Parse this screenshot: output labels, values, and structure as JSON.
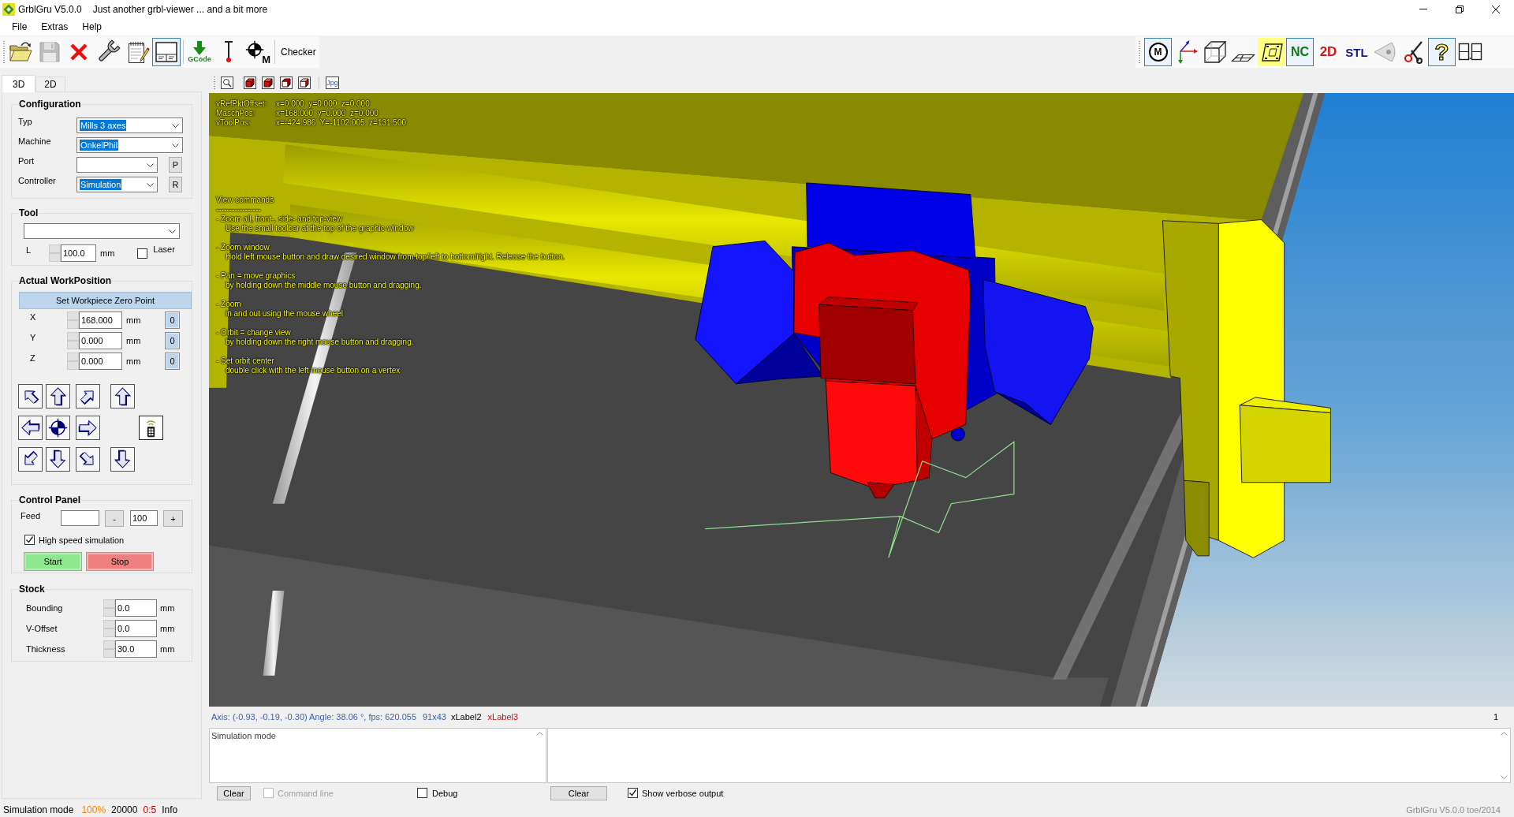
{
  "window": {
    "title": "GrblGru V5.0.0",
    "subtitle": "Just another grbl-viewer ... and a bit more"
  },
  "menu": [
    {
      "label": "File"
    },
    {
      "label": "Extras"
    },
    {
      "label": "Help"
    }
  ],
  "toolbar": {
    "groups": [
      [
        {
          "pressed": false,
          "disabled": false
        },
        {
          "pressed": false,
          "disabled": true
        },
        {
          "pressed": false,
          "disabled": false
        },
        {
          "pressed": false,
          "disabled": false
        },
        {
          "pressed": false,
          "disabled": false
        },
        {
          "pressed": true,
          "disabled": false
        }
      ],
      [
        {
          "label": "GCode",
          "pressed": false,
          "disabled": false
        },
        {
          "pressed": false,
          "disabled": false
        },
        {
          "label": "M",
          "pressed": false,
          "disabled": false
        }
      ],
      [
        {
          "label": "Checker",
          "pressed": false,
          "disabled": false
        }
      ]
    ]
  },
  "view_toolbar": {
    "items": [
      {
        "label": "M",
        "pressed": true,
        "highlighted": false
      },
      {
        "pressed": false,
        "highlighted": false
      },
      {
        "pressed": false,
        "highlighted": false
      },
      {
        "pressed": false,
        "highlighted": false
      },
      {
        "pressed": false,
        "highlighted": true
      },
      {
        "label": "NC",
        "pressed": true,
        "highlighted": false
      },
      {
        "label": "2D",
        "pressed": false,
        "highlighted": false
      },
      {
        "label": "STL",
        "pressed": false,
        "highlighted": false
      },
      {
        "pressed": false,
        "highlighted": false
      },
      {
        "pressed": false,
        "highlighted": false
      },
      {
        "label": "?",
        "pressed": true,
        "highlighted": false
      },
      {
        "pressed": false,
        "highlighted": false
      }
    ]
  },
  "tabs": [
    {
      "label": "3D",
      "selected": true
    },
    {
      "label": "2D",
      "selected": false
    }
  ],
  "view_tools": {
    "export_label": "Jpg"
  },
  "configuration": {
    "title": "Configuration",
    "fields": [
      {
        "label": "Typ",
        "value": "Mills 3 axes",
        "highlighted": true
      },
      {
        "label": "Machine",
        "value": "OnkelPhil",
        "highlighted": true
      },
      {
        "label": "Port",
        "button": "P"
      },
      {
        "label": "Controller",
        "value": "Simulation",
        "highlighted": true,
        "button": "R"
      }
    ]
  },
  "tool": {
    "title": "Tool",
    "length_label": "L",
    "length": "100.0",
    "unit": "mm",
    "laser": {
      "label": "Laser",
      "checked": false
    }
  },
  "work_position": {
    "title": "Actual WorkPosition",
    "zero_button": "Set Workpiece Zero Point",
    "axes": [
      {
        "label": "X",
        "value": "168.000",
        "unit": "mm",
        "button": "0"
      },
      {
        "label": "Y",
        "value": "0.000",
        "unit": "mm",
        "button": "0"
      },
      {
        "label": "Z",
        "value": "0.000",
        "unit": "mm",
        "button": "0"
      }
    ]
  },
  "control_panel": {
    "title": "Control Panel",
    "feed_label": "Feed",
    "minus": "-",
    "override": "100",
    "plus": "+",
    "high_speed": {
      "label": "High speed simulation",
      "checked": true
    },
    "start": "Start",
    "stop": "Stop"
  },
  "stock": {
    "title": "Stock",
    "fields": [
      {
        "label": "Bounding",
        "value": "0.0",
        "unit": "mm"
      },
      {
        "label": "V-Offset",
        "value": "0.0",
        "unit": "mm"
      },
      {
        "label": "Thickness",
        "value": "30.0",
        "unit": "mm"
      }
    ]
  },
  "viewport": {
    "positions": [
      {
        "label": "vRefPktOffset:",
        "values": "x=0.000  y=0.000  z=0.000"
      },
      {
        "label": "MaschPos:",
        "values": "x=168.000  y=0.000  z=0.000"
      },
      {
        "label": "vToolPos:",
        "values": "x=-424.986  Y=-1102.005  z=131.500"
      }
    ],
    "help": {
      "title": "View commands",
      "rule": "-----------------",
      "commands": [
        {
          "name": "- Zoom all, front-, side- and top-view",
          "detail": "Use the small toolbar at the top of the graphic-window"
        },
        {
          "name": "- Zoom window",
          "detail": "Hold left mouse button and draw desired window from top/left to bottom/right. Release the button."
        },
        {
          "name": "- Pan = move graphics",
          "detail": "by holding down the middle mouse button and dragging."
        },
        {
          "name": "- Zoom",
          "detail": "in and out using the mouse wheel"
        },
        {
          "name": "- Orbit = change view",
          "detail": "by holding down the right mouse button and dragging."
        },
        {
          "name": "- Set orbit center",
          "detail": "double click with the left mouse button on a vertex"
        }
      ]
    }
  },
  "info_bar": {
    "axis": "Axis: (-0.93, -0.19, -0.30) Angle: 38.06 °, fps: 620.055",
    "size": "91x43",
    "label_2": "xLabel2",
    "label_3": "xLabel3",
    "count": "1"
  },
  "log": {
    "text": "Simulation mode",
    "clear": "Clear",
    "command_line": {
      "label": "Command line",
      "checked": false,
      "disabled": true
    },
    "debug": {
      "label": "Debug",
      "checked": false,
      "disabled": false
    }
  },
  "verbose_log": {
    "clear": "Clear",
    "verbose": {
      "label": "Show verbose output",
      "checked": true,
      "disabled": false
    }
  },
  "status_bar": {
    "items": [
      {
        "text": "Simulation mode"
      },
      {
        "text": "100%",
        "color": "#ff8000"
      },
      {
        "text": "20000"
      },
      {
        "text": "0:5",
        "color": "#c00000"
      },
      {
        "text": "Info"
      }
    ],
    "copyright": "GrblGru V5.0.0 toe/2014"
  }
}
